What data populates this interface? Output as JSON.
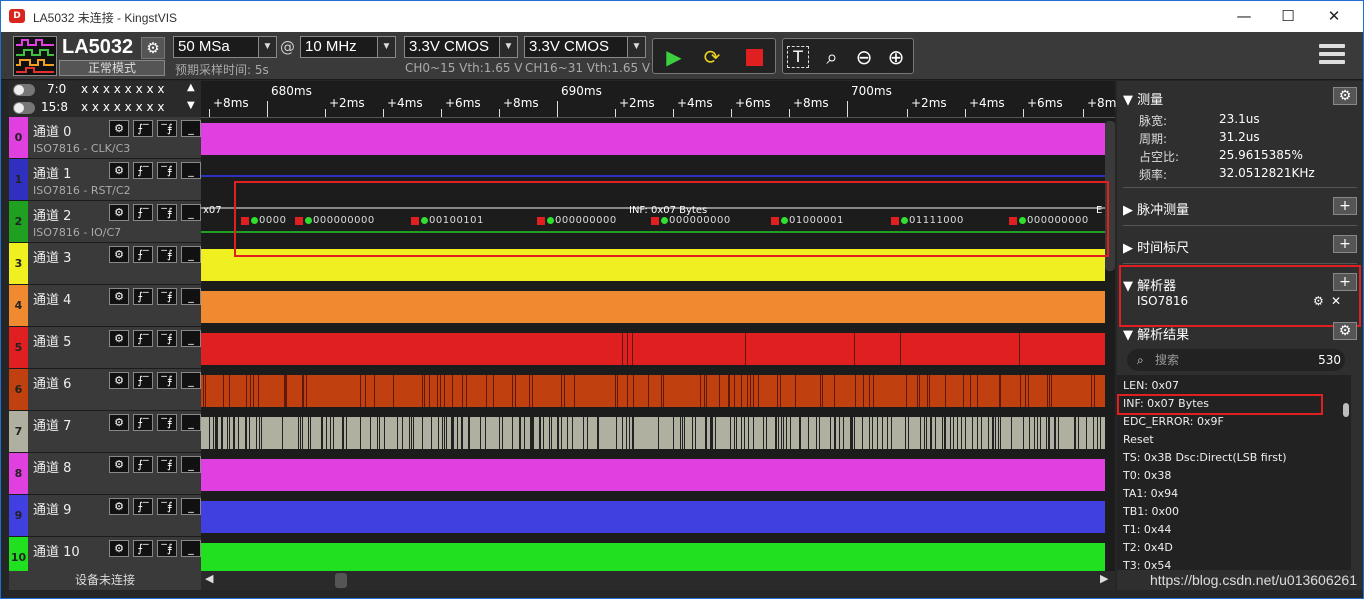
{
  "window": {
    "title": "LA5032 未连接 - KingstVIS",
    "minimize": "—",
    "maximize": "☐",
    "close": "✕"
  },
  "toolbar": {
    "device_name": "LA5032",
    "device_mode": "正常模式",
    "sample_depth": "50 MSa",
    "at": "@",
    "sample_rate": "10 MHz",
    "voltage_a": "3.3V CMOS",
    "voltage_b": "3.3V CMOS",
    "sample_time_hint": "预期采样时间: 5s",
    "vth_a": "CH0~15 Vth:1.65 V",
    "vth_b": "CH16~31 Vth:1.65 V",
    "accent_color": "#3cd03c"
  },
  "channel_groups": [
    {
      "label": "7:0",
      "bits": "x x x x x x x x",
      "arrow": "▲"
    },
    {
      "label": "15:8",
      "bits": "x x x x x x x x",
      "arrow": "▼"
    }
  ],
  "channels": [
    {
      "num": "0",
      "name": "通道 0",
      "sub": "ISO7816 - CLK/C3",
      "color": "#e040e0"
    },
    {
      "num": "1",
      "name": "通道 1",
      "sub": "ISO7816 - RST/C2",
      "color": "#3030c0"
    },
    {
      "num": "2",
      "name": "通道 2",
      "sub": "ISO7816 - IO/C7",
      "color": "#20a020"
    },
    {
      "num": "3",
      "name": "通道 3",
      "sub": "",
      "color": "#f0f020"
    },
    {
      "num": "4",
      "name": "通道 4",
      "sub": "",
      "color": "#f08a30"
    },
    {
      "num": "5",
      "name": "通道 5",
      "sub": "",
      "color": "#e02020"
    },
    {
      "num": "6",
      "name": "通道 6",
      "sub": "",
      "color": "#c04010"
    },
    {
      "num": "7",
      "name": "通道 7",
      "sub": "",
      "color": "#b0b0a0"
    },
    {
      "num": "8",
      "name": "通道 8",
      "sub": "",
      "color": "#e040e0"
    },
    {
      "num": "9",
      "name": "通道 9",
      "sub": "",
      "color": "#4040e0"
    },
    {
      "num": "10",
      "name": "通道 10",
      "sub": "",
      "color": "#20e020"
    }
  ],
  "channel_controls": [
    "⚙",
    "⨍‾",
    "‾⨎",
    "_"
  ],
  "device_status": "设备未连接",
  "ruler": {
    "labels": [
      "+8ms",
      "680ms",
      "+2ms",
      "+4ms",
      "+6ms",
      "+8ms",
      "690ms",
      "+2ms",
      "+4ms",
      "+6ms",
      "+8ms",
      "700ms",
      "+2ms",
      "+4ms",
      "+6ms",
      "+8ms"
    ]
  },
  "decoder": {
    "label_left": "x07",
    "inf_label": "INF: 0x07 Bytes",
    "label_right": "E",
    "bytes": [
      "0000",
      "000000000",
      "00100101",
      "000000000",
      "000000000",
      "01000001",
      "01111000",
      "000000000"
    ]
  },
  "right_panel": {
    "measure": {
      "title": "测量",
      "items": [
        {
          "key": "脉宽:",
          "value": "23.1us"
        },
        {
          "key": "周期:",
          "value": "31.2us"
        },
        {
          "key": "占空比:",
          "value": "25.9615385%"
        },
        {
          "key": "频率:",
          "value": "32.0512821KHz"
        }
      ]
    },
    "pulse_measure": {
      "title": "脉冲测量"
    },
    "time_marker": {
      "title": "时间标尺"
    },
    "analyzer": {
      "title": "解析器",
      "item": "ISO7816"
    },
    "results": {
      "title": "解析结果",
      "search_placeholder": "搜索",
      "count": "530",
      "rows": [
        "LEN: 0x07",
        "INF: 0x07 Bytes",
        "EDC_ERROR: 0x9F",
        "Reset",
        "TS: 0x3B Dsc:Direct(LSB first)",
        "T0: 0x38",
        "TA1: 0x94",
        "TB1: 0x00",
        "T1: 0x44",
        "T2: 0x4D",
        "T3: 0x54"
      ]
    }
  },
  "watermark": "https://blog.csdn.net/u013606261"
}
